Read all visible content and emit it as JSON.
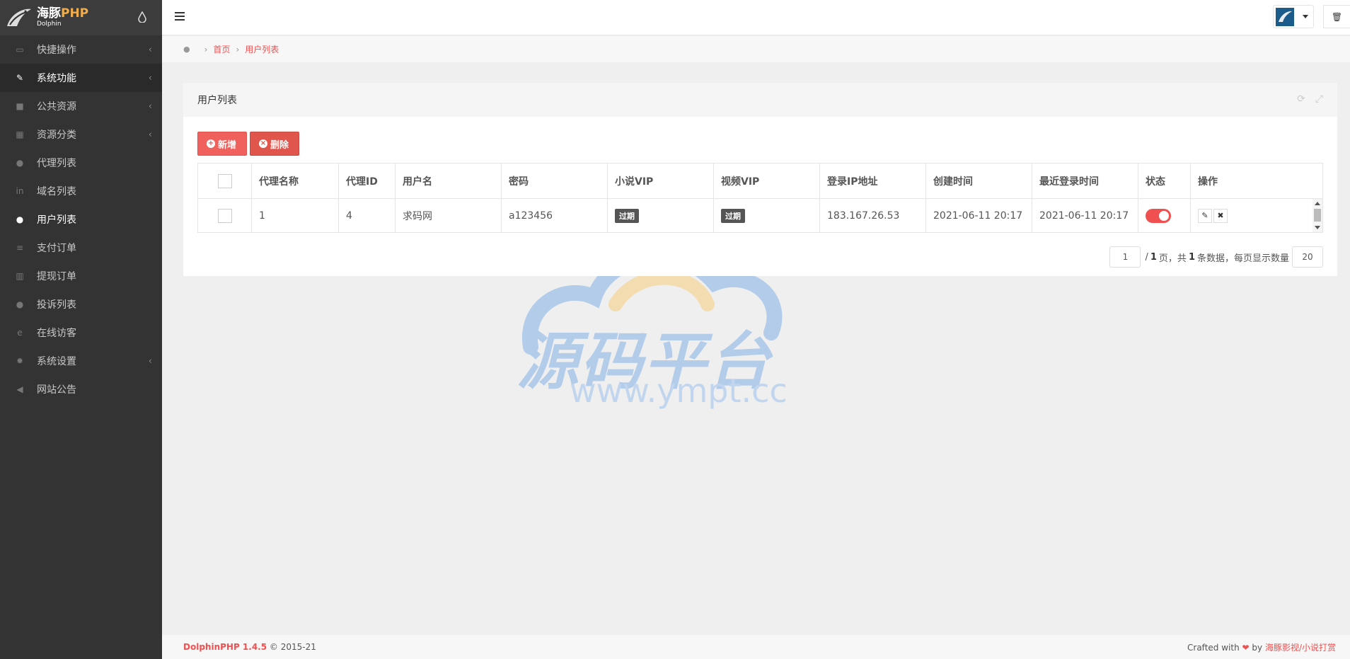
{
  "sidebar": {
    "brand_cn": "海豚",
    "brand_php": "PHP",
    "brand_en": "Dolphin",
    "items": [
      {
        "label": "快捷操作",
        "icon": "folder-open-icon",
        "arrow": true
      },
      {
        "label": "系统功能",
        "icon": "wrench-icon",
        "arrow": true
      },
      {
        "label": "公共资源",
        "icon": "video-camera-icon",
        "arrow": true
      },
      {
        "label": "资源分类",
        "icon": "grid-icon",
        "arrow": true
      },
      {
        "label": "代理列表",
        "icon": "users-icon",
        "arrow": false
      },
      {
        "label": "域名列表",
        "icon": "linkedin-icon",
        "arrow": false
      },
      {
        "label": "用户列表",
        "icon": "user-icon",
        "arrow": false
      },
      {
        "label": "支付订单",
        "icon": "database-icon",
        "arrow": false
      },
      {
        "label": "提现订单",
        "icon": "bank-icon",
        "arrow": false
      },
      {
        "label": "投诉列表",
        "icon": "exclamation-circle-icon",
        "arrow": false
      },
      {
        "label": "在线访客",
        "icon": "ie-icon",
        "arrow": false
      },
      {
        "label": "系统设置",
        "icon": "gear-icon",
        "arrow": true
      },
      {
        "label": "网站公告",
        "icon": "bullhorn-icon",
        "arrow": false
      }
    ]
  },
  "breadcrumb": {
    "home": "首页",
    "current": "用户列表"
  },
  "panel": {
    "title": "用户列表",
    "add_label": "新增",
    "delete_label": "删除"
  },
  "table": {
    "headers": [
      "代理名称",
      "代理ID",
      "用户名",
      "密码",
      "小说VIP",
      "视频VIP",
      "登录IP地址",
      "创建时间",
      "最近登录时间",
      "状态",
      "操作"
    ],
    "rows": [
      {
        "agent_name": "1",
        "agent_id": "4",
        "username": "求码网",
        "password": "a123456",
        "novel_vip": "过期",
        "video_vip": "过期",
        "login_ip": "183.167.26.53",
        "created": "2021-06-11 20:17",
        "last_login": "2021-06-11 20:17",
        "status_on": true
      }
    ]
  },
  "pager": {
    "page": "1",
    "total_pages": "1",
    "text_page": "页，共",
    "total": "1",
    "text_count": "条数据，每页显示数量",
    "per_page": "20"
  },
  "watermark": {
    "cn": "源码平台",
    "url": "www.ympt.cc"
  },
  "footer": {
    "brand": "DolphinPHP 1.4.5",
    "copyright": "© 2015-21",
    "crafted": "Crafted with",
    "by": "by",
    "link": "海豚影视/小说打赏"
  },
  "colors": {
    "accent": "#f05050",
    "sidebar_bg": "#333333",
    "badge": "#555555"
  }
}
